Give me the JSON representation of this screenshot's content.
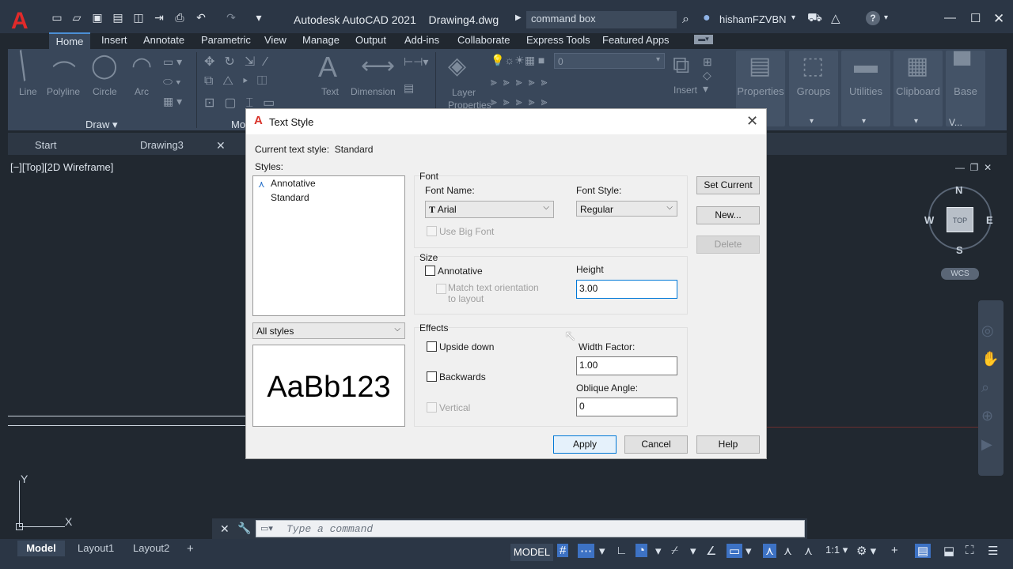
{
  "app": {
    "title": "Autodesk AutoCAD 2021",
    "file": "Drawing4.dwg",
    "command_box": "command box",
    "username": "hishamFZVBN",
    "logo": "A"
  },
  "ribbon_tabs": [
    "Home",
    "Insert",
    "Annotate",
    "Parametric",
    "View",
    "Manage",
    "Output",
    "Add-ins",
    "Collaborate",
    "Express Tools",
    "Featured Apps"
  ],
  "ribbon": {
    "draw_tools": [
      "Line",
      "Polyline",
      "Circle",
      "Arc"
    ],
    "draw_title": "Draw",
    "modify_title": "Mo",
    "annotation_tools": [
      "Text",
      "Dimension"
    ],
    "layer_props": "Layer Properties",
    "layer_value": "0",
    "insert": "Insert",
    "properties": "Properties",
    "groups": "Groups",
    "utilities": "Utilities",
    "clipboard": "Clipboard",
    "base": "Base",
    "view_short": "V..."
  },
  "doc_tabs": [
    "Start",
    "Drawing3"
  ],
  "viewport_label": "[−][Top][2D Wireframe]",
  "compass": {
    "n": "N",
    "s": "S",
    "e": "E",
    "w": "W",
    "top": "TOP",
    "wcs": "WCS"
  },
  "ucs": {
    "y": "Y",
    "x": "X"
  },
  "dialog": {
    "title": "Text Style",
    "current_label": "Current text style:",
    "current_value": "Standard",
    "styles_label": "Styles:",
    "styles": [
      "Annotative",
      "Standard"
    ],
    "filter": "All styles",
    "preview": "AaBb123",
    "font_group": "Font",
    "font_name_label": "Font Name:",
    "font_name": "Arial",
    "font_style_label": "Font Style:",
    "font_style": "Regular",
    "big_font": "Use Big Font",
    "size_group": "Size",
    "annotative": "Annotative",
    "match_orientation": "Match text orientation to layout",
    "height_label": "Height",
    "height": "3.00",
    "effects_group": "Effects",
    "upside_down": "Upside down",
    "backwards": "Backwards",
    "vertical": "Vertical",
    "width_factor_label": "Width Factor:",
    "width_factor": "1.00",
    "oblique_label": "Oblique Angle:",
    "oblique": "0",
    "btn_set_current": "Set Current",
    "btn_new": "New...",
    "btn_delete": "Delete",
    "btn_apply": "Apply",
    "btn_cancel": "Cancel",
    "btn_help": "Help"
  },
  "command_line": {
    "placeholder": "Type a command"
  },
  "layouts": [
    "Model",
    "Layout1",
    "Layout2"
  ],
  "status": {
    "model": "MODEL",
    "scale": "1:1"
  }
}
